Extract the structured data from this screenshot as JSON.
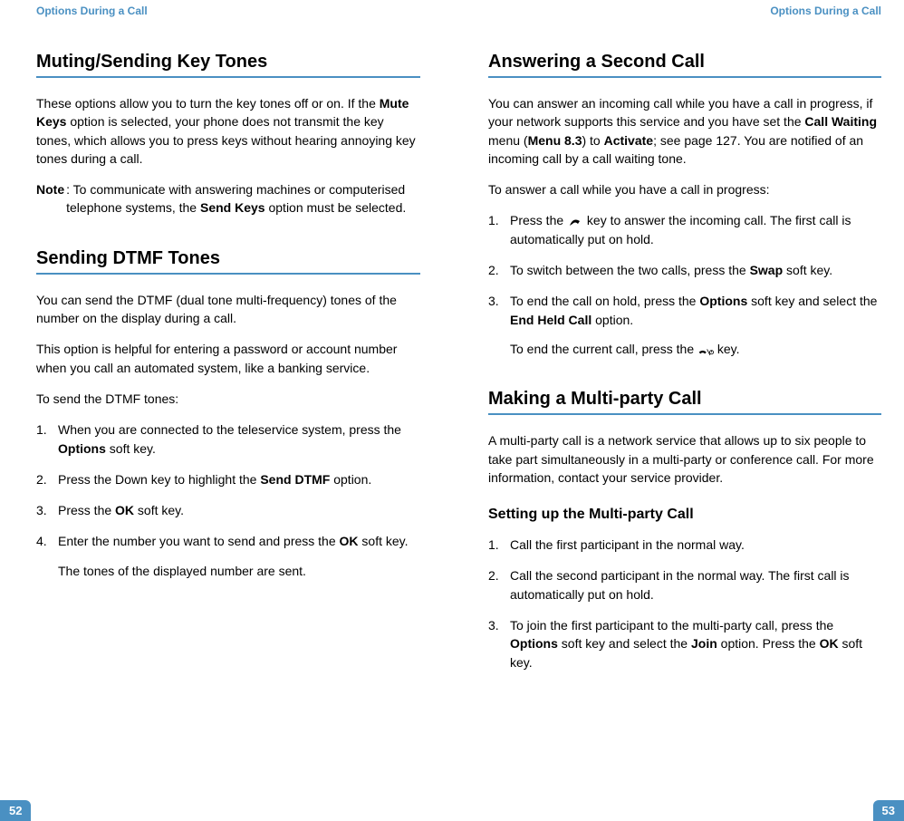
{
  "leftPage": {
    "runningHead": "Options During a Call",
    "pageNumber": "52",
    "section1": {
      "title": "Muting/Sending Key Tones",
      "p1_pre": "These options allow you to turn the key tones off or on. If the ",
      "p1_b1": "Mute Keys",
      "p1_post": " option is selected, your phone does not transmit the key tones, which allows you to press keys without hearing annoying key tones during a call.",
      "note_label": "Note",
      "note_pre": ": To communicate with answering machines or computerised telephone systems, the ",
      "note_b1": "Send Keys",
      "note_post": " option must be selected."
    },
    "section2": {
      "title": "Sending DTMF Tones",
      "p1": "You can send the DTMF (dual tone multi-frequency) tones of the number on the display during a call.",
      "p2": "This option is helpful for entering a password or account number when you call an automated system, like a banking service.",
      "p3": "To send the DTMF tones:",
      "li1_pre": "When you are connected to the teleservice system, press the ",
      "li1_b1": "Options",
      "li1_post": " soft key.",
      "li2_pre": "Press the Down key to highlight the ",
      "li2_b1": "Send DTMF",
      "li2_post": " option.",
      "li3_pre": "Press the ",
      "li3_b1": "OK",
      "li3_post": " soft key.",
      "li4_pre": "Enter the number you want to send and press the ",
      "li4_b1": "OK",
      "li4_post": " soft key.",
      "li4_follow": "The tones of the displayed number are sent."
    }
  },
  "rightPage": {
    "runningHead": "Options During a Call",
    "pageNumber": "53",
    "section1": {
      "title": "Answering a Second Call",
      "p1_pre": "You can answer an incoming call while you have a call in progress, if your network supports this service and you have set the ",
      "p1_b1": "Call Waiting",
      "p1_mid1": " menu (",
      "p1_b2": "Menu 8.3",
      "p1_mid2": ") to ",
      "p1_b3": "Activate",
      "p1_post": "; see page 127. You are notified of an incoming call by a call waiting tone.",
      "p2": "To answer a call while you have a call in progress:",
      "li1_pre": "Press the ",
      "li1_post": " key to answer the incoming call. The first call is automatically put on hold.",
      "li2_pre": "To switch between the two calls, press the ",
      "li2_b1": "Swap",
      "li2_post": " soft key.",
      "li3_pre": "To end the call on hold, press the ",
      "li3_b1": "Options",
      "li3_mid": " soft key and select the ",
      "li3_b2": "End Held Call",
      "li3_post": " option.",
      "li3_follow_pre": "To end the current call, press the ",
      "li3_follow_post": " key."
    },
    "section2": {
      "title": "Making a Multi-party Call",
      "p1": "A multi-party call is a network service that allows up to six people to take part simultaneously in a multi-party or conference call. For more information, contact your service provider.",
      "sub_title": "Setting up the Multi-party Call",
      "li1": "Call the first participant in the normal way.",
      "li2": "Call the second participant in the normal way. The first call is automatically put on hold.",
      "li3_pre": "To join the first participant to the multi-party call, press the ",
      "li3_b1": "Options",
      "li3_mid1": " soft key and select the ",
      "li3_b2": "Join",
      "li3_mid2": " option. Press the ",
      "li3_b3": "OK",
      "li3_post": " soft key."
    }
  }
}
